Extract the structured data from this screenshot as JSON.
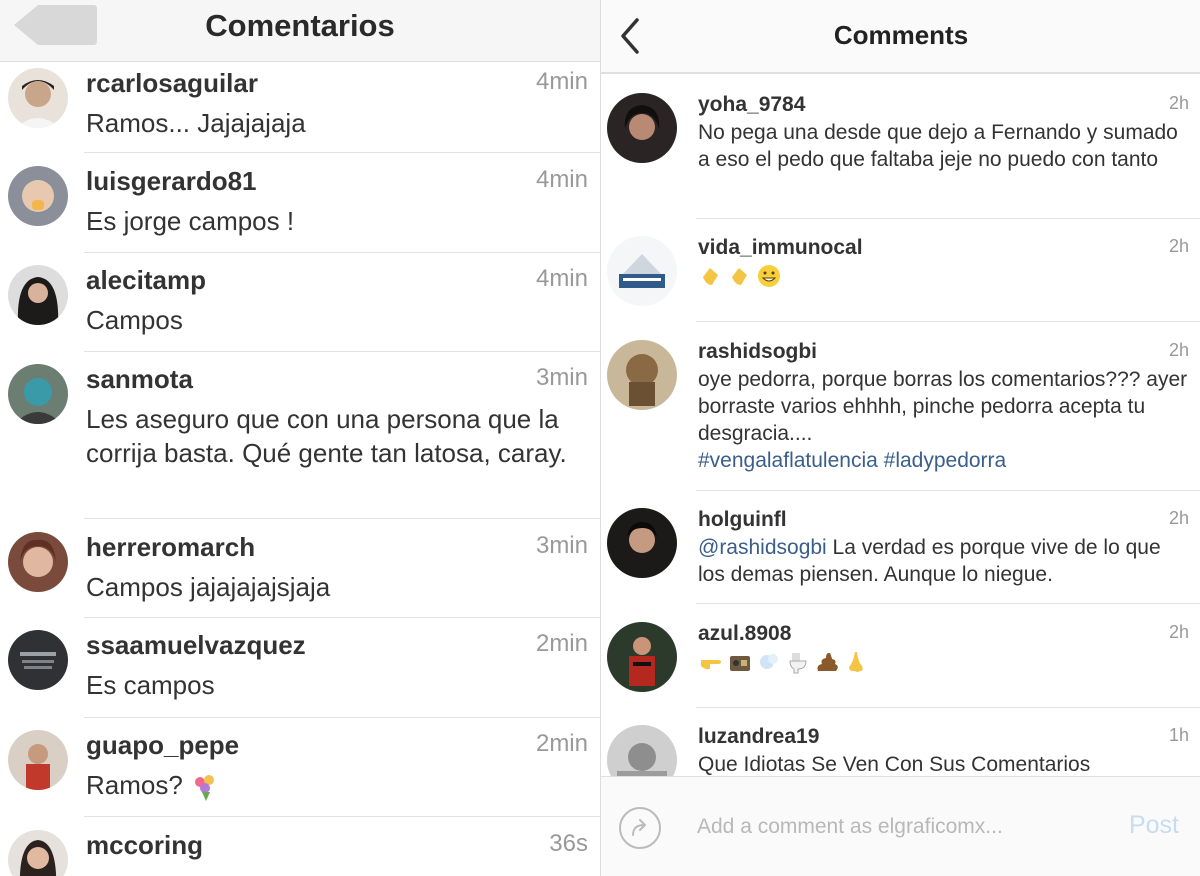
{
  "left": {
    "title": "Comentarios",
    "comments": [
      {
        "user": "rcarlosaguilar",
        "time": "4min",
        "text": "Ramos... Jajajajaja"
      },
      {
        "user": "luisgerardo81",
        "time": "4min",
        "text": "Es jorge campos !"
      },
      {
        "user": "alecitamp",
        "time": "4min",
        "text": "Campos"
      },
      {
        "user": "sanmota",
        "time": "3min",
        "text": "Les aseguro que con una persona que la corrija basta. Qué gente tan latosa, caray."
      },
      {
        "user": "herreromarch",
        "time": "3min",
        "text": "Campos jajajajajsjaja"
      },
      {
        "user": "ssaamuelvazquez",
        "time": "2min",
        "text": "Es campos"
      },
      {
        "user": "guapo_pepe",
        "time": "2min",
        "text": "Ramos?"
      },
      {
        "user": "mccoring",
        "time": "36s",
        "text": ""
      }
    ]
  },
  "right": {
    "title": "Comments",
    "comments": [
      {
        "user": "yoha_9784",
        "time": "2h",
        "text": "No pega una desde que dejo a Fernando y sumado a eso el pedo que faltaba jeje no puedo con tanto"
      },
      {
        "user": "vida_immunocal",
        "time": "2h",
        "text": ""
      },
      {
        "user": "rashidsogbi",
        "time": "2h",
        "text": "oye pedorra, porque borras los comentarios??? ayer borraste varios ehhhh, pinche pedorra acepta tu desgracia....",
        "tags": "#vengalaflatulencia #ladypedorra"
      },
      {
        "user": "holguinfl",
        "time": "2h",
        "mention": "@rashidsogbi",
        "text": " La verdad es porque vive de lo que los demas piensen. Aunque lo niegue."
      },
      {
        "user": "azul.8908",
        "time": "2h",
        "text": ""
      },
      {
        "user": "luzandrea19",
        "time": "1h",
        "text": "Que Idiotas Se Ven Con Sus Comentarios"
      }
    ],
    "input_placeholder": "Add a comment as elgraficomx...",
    "post_label": "Post"
  },
  "icons": {
    "back": "chevron-left-icon",
    "share": "share-circle-icon"
  }
}
